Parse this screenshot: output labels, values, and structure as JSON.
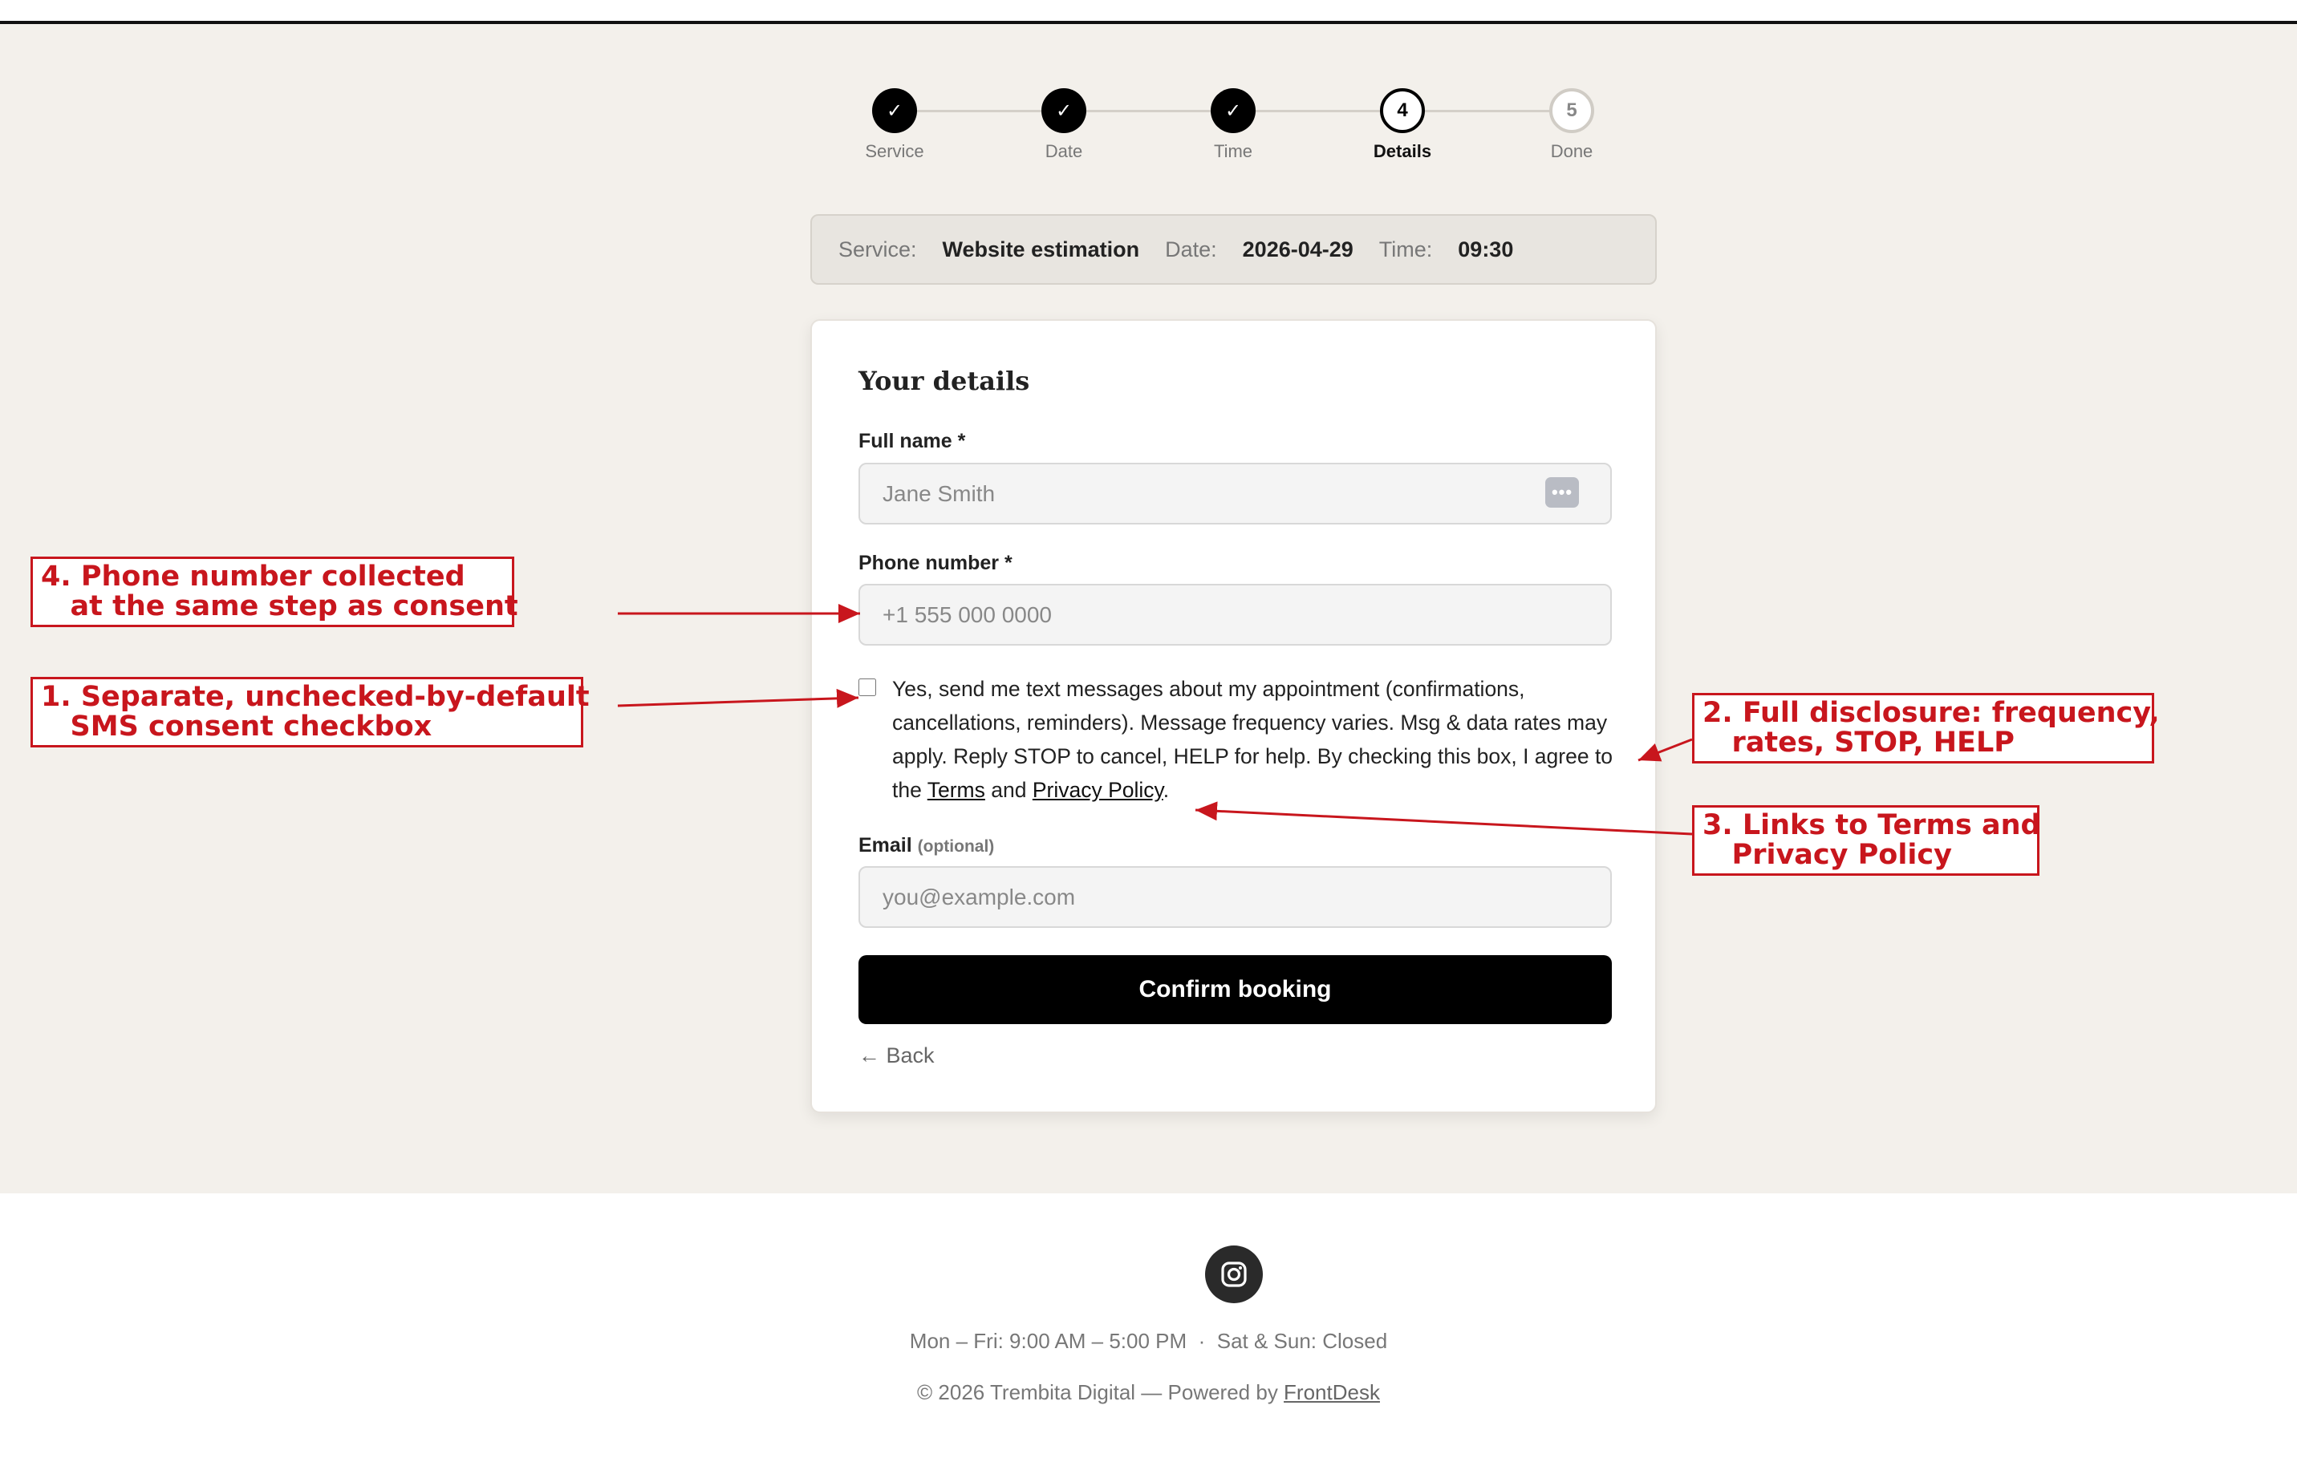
{
  "stepper": {
    "steps": [
      {
        "label": "Service",
        "mark": "✓"
      },
      {
        "label": "Date",
        "mark": "✓"
      },
      {
        "label": "Time",
        "mark": "✓"
      },
      {
        "label": "Details",
        "mark": "4"
      },
      {
        "label": "Done",
        "mark": "5"
      }
    ]
  },
  "summary": {
    "service_key": "Service:",
    "service_value": "Website estimation",
    "date_key": "Date:",
    "date_value": "2026-04-29",
    "time_key": "Time:",
    "time_value": "09:30"
  },
  "form": {
    "title": "Your details",
    "full_name_label": "Full name *",
    "full_name_placeholder": "Jane Smith",
    "autofill_icon": "•••",
    "phone_label": "Phone number *",
    "phone_placeholder": "+1 555 000 0000",
    "sms_text_before": "Yes, send me text messages about my appointment (confirmations, cancellations, reminders). Message frequency varies. Msg & data rates may apply. Reply STOP to cancel, HELP for help. By checking this box, I agree to the ",
    "terms_link": "Terms",
    "sms_and": " and ",
    "privacy_link": "Privacy Policy",
    "sms_end": ".",
    "email_label": "Email",
    "email_optional": "(optional)",
    "email_placeholder": "you@example.com",
    "confirm_label": "Confirm booking",
    "back_label": "← Back"
  },
  "footer": {
    "hours": "Mon – Fri: 9:00 AM – 5:00 PM  ·  Sat & Sun: Closed",
    "copyright": "© 2026 Trembita Digital — Powered by ",
    "powered_link": "FrontDesk",
    "social_icon": "instagram-icon"
  },
  "annotations": {
    "a4": "4. Phone number collected\n   at the same step as consent",
    "a1": "1. Separate, unchecked-by-default\n   SMS consent checkbox",
    "a2": "2. Full disclosure: frequency,\n   rates, STOP, HELP",
    "a3": "3. Links to Terms and\n   Privacy Policy"
  },
  "colors": {
    "page_bg": "#f3f0eb",
    "annotation": "#c8161d",
    "primary_button": "#000000"
  }
}
